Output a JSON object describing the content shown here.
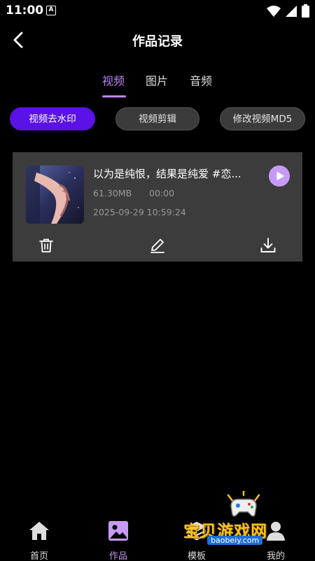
{
  "status_bar": {
    "time": "11:00",
    "notification_badge": "A"
  },
  "header": {
    "title": "作品记录"
  },
  "tabs": [
    {
      "label": "视频",
      "active": true
    },
    {
      "label": "图片",
      "active": false
    },
    {
      "label": "音频",
      "active": false
    }
  ],
  "actions": [
    {
      "label": "视频去水印",
      "active": true
    },
    {
      "label": "视频剪辑",
      "active": false
    },
    {
      "label": "修改视频MD5",
      "active": false
    }
  ],
  "records": [
    {
      "title": "以为是纯恨，结果是纯爱 #恋...",
      "size": "61.30MB",
      "duration": "00:00",
      "date": "2025-09-29 10:59:24"
    }
  ],
  "bottom_nav": [
    {
      "label": "首页",
      "icon": "home-icon",
      "active": false
    },
    {
      "label": "作品",
      "icon": "image-icon",
      "active": true
    },
    {
      "label": "模板",
      "icon": "template-icon",
      "active": false
    },
    {
      "label": "我的",
      "icon": "profile-icon",
      "active": false
    }
  ],
  "watermark": {
    "text": "宝贝游戏网",
    "url": "baobeiy.com"
  },
  "colors": {
    "accent": "#b985f5",
    "active_pill": "#5a12e6",
    "card_bg": "#3c3c3c",
    "play": "#c89af7"
  }
}
